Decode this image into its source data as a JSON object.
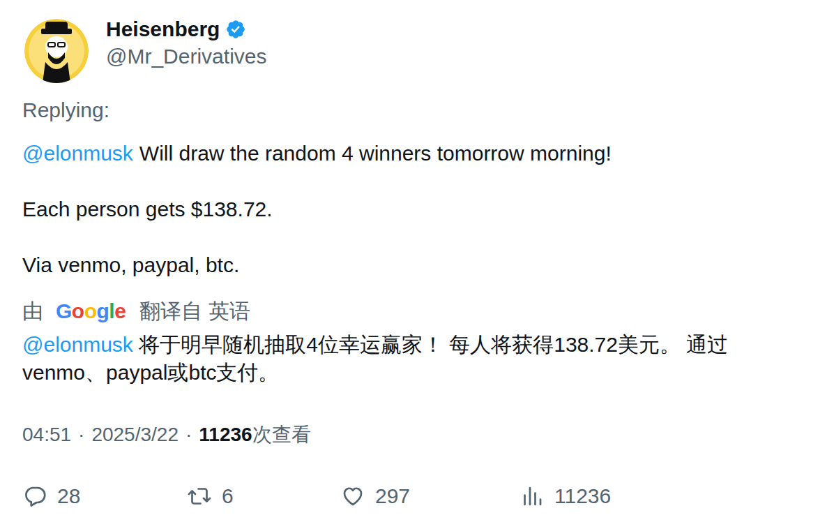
{
  "author": {
    "name": "Heisenberg",
    "handle": "@Mr_Derivatives",
    "verified": true
  },
  "replying_label": "Replying:",
  "body": {
    "mention": "@elonmusk",
    "paragraphs": [
      "Will draw the random 4 winners tomorrow morning!",
      "Each person gets $138.72.",
      "Via venmo, paypal, btc."
    ]
  },
  "translation": {
    "prefix": "由",
    "provider": "Google",
    "suffix": "翻译自 英语",
    "mention": "@elonmusk",
    "text": "将于明早随机抽取4位幸运赢家！ 每人将获得138.72美元。 通过venmo、paypal或btc支付。"
  },
  "meta": {
    "time": "04:51",
    "separator": "·",
    "date": "2025/3/22",
    "views": "11236",
    "views_label": "次查看"
  },
  "actions": [
    {
      "kind": "reply",
      "count": "28"
    },
    {
      "kind": "retweet",
      "count": "6"
    },
    {
      "kind": "like",
      "count": "297"
    },
    {
      "kind": "views",
      "count": "11236"
    }
  ]
}
